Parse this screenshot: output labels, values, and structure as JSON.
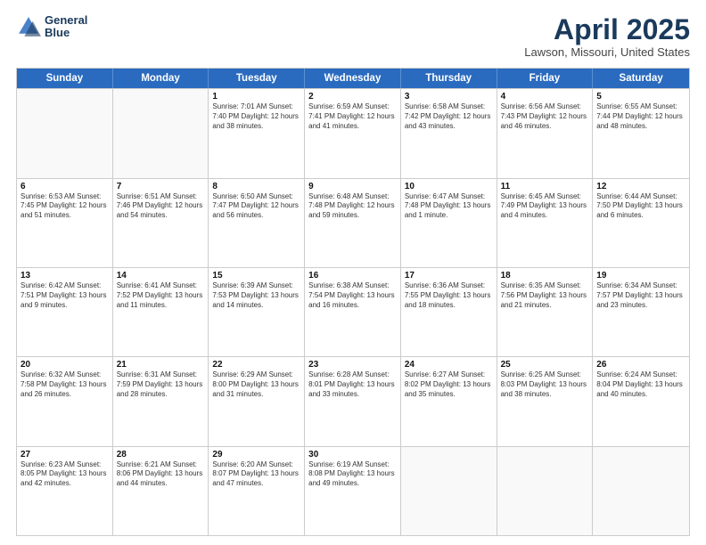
{
  "header": {
    "logo_line1": "General",
    "logo_line2": "Blue",
    "month": "April 2025",
    "location": "Lawson, Missouri, United States"
  },
  "weekdays": [
    "Sunday",
    "Monday",
    "Tuesday",
    "Wednesday",
    "Thursday",
    "Friday",
    "Saturday"
  ],
  "weeks": [
    [
      {
        "day": "",
        "info": ""
      },
      {
        "day": "",
        "info": ""
      },
      {
        "day": "1",
        "info": "Sunrise: 7:01 AM\nSunset: 7:40 PM\nDaylight: 12 hours and 38 minutes."
      },
      {
        "day": "2",
        "info": "Sunrise: 6:59 AM\nSunset: 7:41 PM\nDaylight: 12 hours and 41 minutes."
      },
      {
        "day": "3",
        "info": "Sunrise: 6:58 AM\nSunset: 7:42 PM\nDaylight: 12 hours and 43 minutes."
      },
      {
        "day": "4",
        "info": "Sunrise: 6:56 AM\nSunset: 7:43 PM\nDaylight: 12 hours and 46 minutes."
      },
      {
        "day": "5",
        "info": "Sunrise: 6:55 AM\nSunset: 7:44 PM\nDaylight: 12 hours and 48 minutes."
      }
    ],
    [
      {
        "day": "6",
        "info": "Sunrise: 6:53 AM\nSunset: 7:45 PM\nDaylight: 12 hours and 51 minutes."
      },
      {
        "day": "7",
        "info": "Sunrise: 6:51 AM\nSunset: 7:46 PM\nDaylight: 12 hours and 54 minutes."
      },
      {
        "day": "8",
        "info": "Sunrise: 6:50 AM\nSunset: 7:47 PM\nDaylight: 12 hours and 56 minutes."
      },
      {
        "day": "9",
        "info": "Sunrise: 6:48 AM\nSunset: 7:48 PM\nDaylight: 12 hours and 59 minutes."
      },
      {
        "day": "10",
        "info": "Sunrise: 6:47 AM\nSunset: 7:48 PM\nDaylight: 13 hours and 1 minute."
      },
      {
        "day": "11",
        "info": "Sunrise: 6:45 AM\nSunset: 7:49 PM\nDaylight: 13 hours and 4 minutes."
      },
      {
        "day": "12",
        "info": "Sunrise: 6:44 AM\nSunset: 7:50 PM\nDaylight: 13 hours and 6 minutes."
      }
    ],
    [
      {
        "day": "13",
        "info": "Sunrise: 6:42 AM\nSunset: 7:51 PM\nDaylight: 13 hours and 9 minutes."
      },
      {
        "day": "14",
        "info": "Sunrise: 6:41 AM\nSunset: 7:52 PM\nDaylight: 13 hours and 11 minutes."
      },
      {
        "day": "15",
        "info": "Sunrise: 6:39 AM\nSunset: 7:53 PM\nDaylight: 13 hours and 14 minutes."
      },
      {
        "day": "16",
        "info": "Sunrise: 6:38 AM\nSunset: 7:54 PM\nDaylight: 13 hours and 16 minutes."
      },
      {
        "day": "17",
        "info": "Sunrise: 6:36 AM\nSunset: 7:55 PM\nDaylight: 13 hours and 18 minutes."
      },
      {
        "day": "18",
        "info": "Sunrise: 6:35 AM\nSunset: 7:56 PM\nDaylight: 13 hours and 21 minutes."
      },
      {
        "day": "19",
        "info": "Sunrise: 6:34 AM\nSunset: 7:57 PM\nDaylight: 13 hours and 23 minutes."
      }
    ],
    [
      {
        "day": "20",
        "info": "Sunrise: 6:32 AM\nSunset: 7:58 PM\nDaylight: 13 hours and 26 minutes."
      },
      {
        "day": "21",
        "info": "Sunrise: 6:31 AM\nSunset: 7:59 PM\nDaylight: 13 hours and 28 minutes."
      },
      {
        "day": "22",
        "info": "Sunrise: 6:29 AM\nSunset: 8:00 PM\nDaylight: 13 hours and 31 minutes."
      },
      {
        "day": "23",
        "info": "Sunrise: 6:28 AM\nSunset: 8:01 PM\nDaylight: 13 hours and 33 minutes."
      },
      {
        "day": "24",
        "info": "Sunrise: 6:27 AM\nSunset: 8:02 PM\nDaylight: 13 hours and 35 minutes."
      },
      {
        "day": "25",
        "info": "Sunrise: 6:25 AM\nSunset: 8:03 PM\nDaylight: 13 hours and 38 minutes."
      },
      {
        "day": "26",
        "info": "Sunrise: 6:24 AM\nSunset: 8:04 PM\nDaylight: 13 hours and 40 minutes."
      }
    ],
    [
      {
        "day": "27",
        "info": "Sunrise: 6:23 AM\nSunset: 8:05 PM\nDaylight: 13 hours and 42 minutes."
      },
      {
        "day": "28",
        "info": "Sunrise: 6:21 AM\nSunset: 8:06 PM\nDaylight: 13 hours and 44 minutes."
      },
      {
        "day": "29",
        "info": "Sunrise: 6:20 AM\nSunset: 8:07 PM\nDaylight: 13 hours and 47 minutes."
      },
      {
        "day": "30",
        "info": "Sunrise: 6:19 AM\nSunset: 8:08 PM\nDaylight: 13 hours and 49 minutes."
      },
      {
        "day": "",
        "info": ""
      },
      {
        "day": "",
        "info": ""
      },
      {
        "day": "",
        "info": ""
      }
    ]
  ]
}
